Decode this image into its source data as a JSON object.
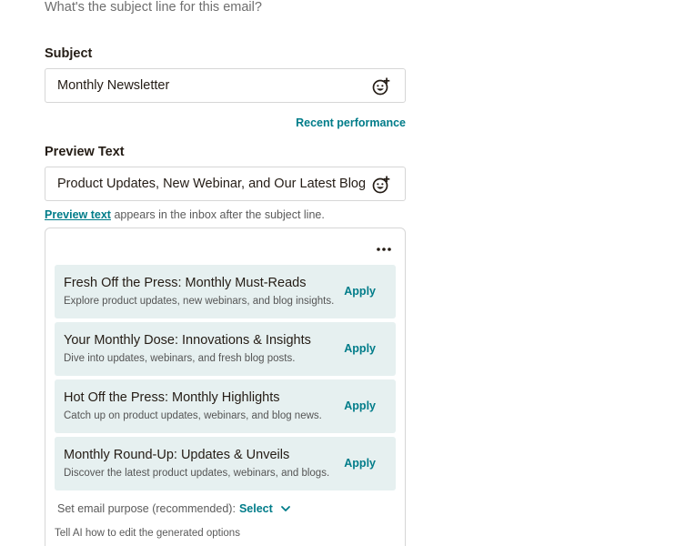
{
  "question": "What's the subject line for this email?",
  "subject": {
    "label": "Subject",
    "value": "Monthly Newsletter",
    "emoji_icon": "emoji-add-icon"
  },
  "recent_performance": "Recent performance",
  "preview": {
    "label": "Preview Text",
    "value": "Product Updates, New Webinar, and Our Latest Blog Posts",
    "emoji_icon": "emoji-add-icon"
  },
  "helper": {
    "link": "Preview text",
    "rest": " appears in the inbox after the subject line."
  },
  "suggestions": [
    {
      "title": "Fresh Off the Press: Monthly Must-Reads",
      "description": "Explore product updates, new webinars, and blog insights.",
      "apply": "Apply"
    },
    {
      "title": "Your Monthly Dose: Innovations & Insights",
      "description": "Dive into updates, webinars, and fresh blog posts.",
      "apply": "Apply"
    },
    {
      "title": "Hot Off the Press: Monthly Highlights",
      "description": "Catch up on product updates, webinars, and blog news.",
      "apply": "Apply"
    },
    {
      "title": "Monthly Round-Up: Updates & Unveils",
      "description": "Discover the latest product updates, webinars, and blogs.",
      "apply": "Apply"
    }
  ],
  "purpose": {
    "label": "Set email purpose (recommended):",
    "select": "Select"
  },
  "tell_ai": "Tell AI how to edit the generated options",
  "colors": {
    "accent": "#007c89",
    "card_bg": "#e6f0f0",
    "border": "#d6d6d6",
    "text": "#241c15"
  }
}
